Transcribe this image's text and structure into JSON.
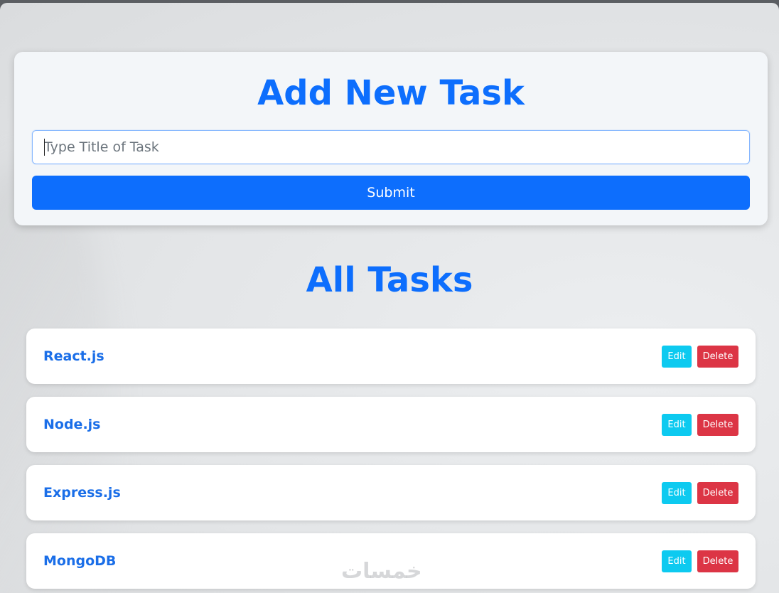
{
  "form": {
    "title": "Add New Task",
    "input_placeholder": "Type Title of Task",
    "input_value": "",
    "submit_label": "Submit"
  },
  "list": {
    "title": "All Tasks",
    "tasks": [
      {
        "title": "React.js",
        "edit_label": "Edit",
        "delete_label": "Delete"
      },
      {
        "title": "Node.js",
        "edit_label": "Edit",
        "delete_label": "Delete"
      },
      {
        "title": "Express.js",
        "edit_label": "Edit",
        "delete_label": "Delete"
      },
      {
        "title": "MongoDB",
        "edit_label": "Edit",
        "delete_label": "Delete"
      }
    ]
  },
  "watermark": "خمسات",
  "colors": {
    "primary": "#0d6efd",
    "info": "#0dcaf0",
    "danger": "#dc3545"
  }
}
